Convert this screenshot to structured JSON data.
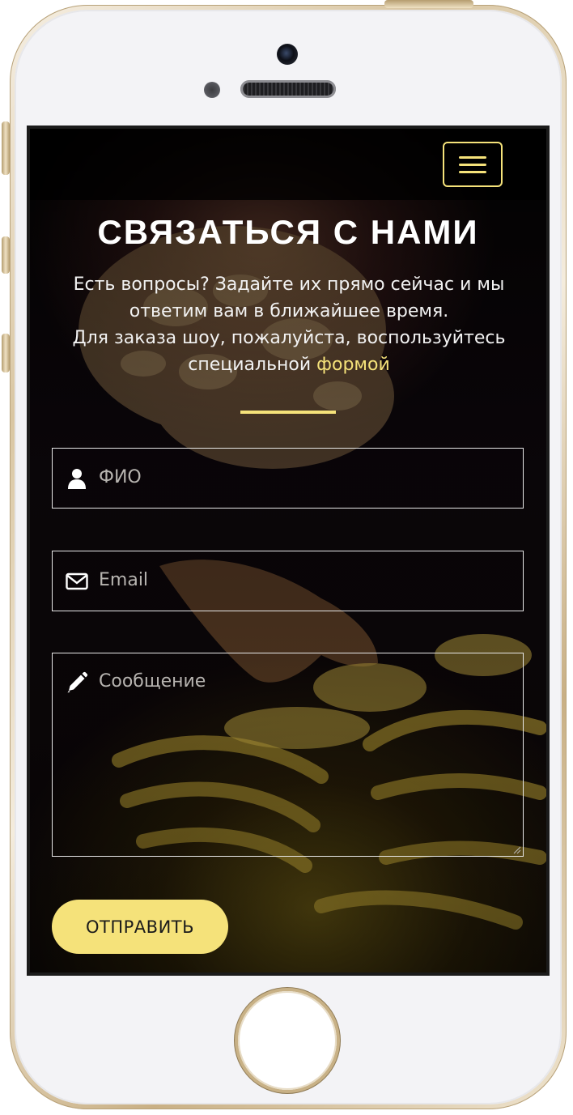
{
  "header": {
    "menu_icon": "hamburger-menu-icon"
  },
  "contact": {
    "title": "СВЯЗАТЬСЯ С НАМИ",
    "lead_line1": "Есть вопросы? Задайте их прямо сейчас и мы ответим вам в ближайшее время.",
    "lead_line2_prefix": "Для заказа шоу, пожалуйста, воспользуйтесь специальной",
    "lead_link": "формой"
  },
  "form": {
    "name_placeholder": "ФИО",
    "name_icon": "user-icon",
    "email_placeholder": "Email",
    "email_icon": "envelope-icon",
    "message_placeholder": "Сообщение",
    "message_icon": "pencil-icon",
    "submit_label": "ОТПРАВИТЬ"
  },
  "colors": {
    "accent": "#f5e27a",
    "text": "#ffffff",
    "background": "#0a0608"
  }
}
